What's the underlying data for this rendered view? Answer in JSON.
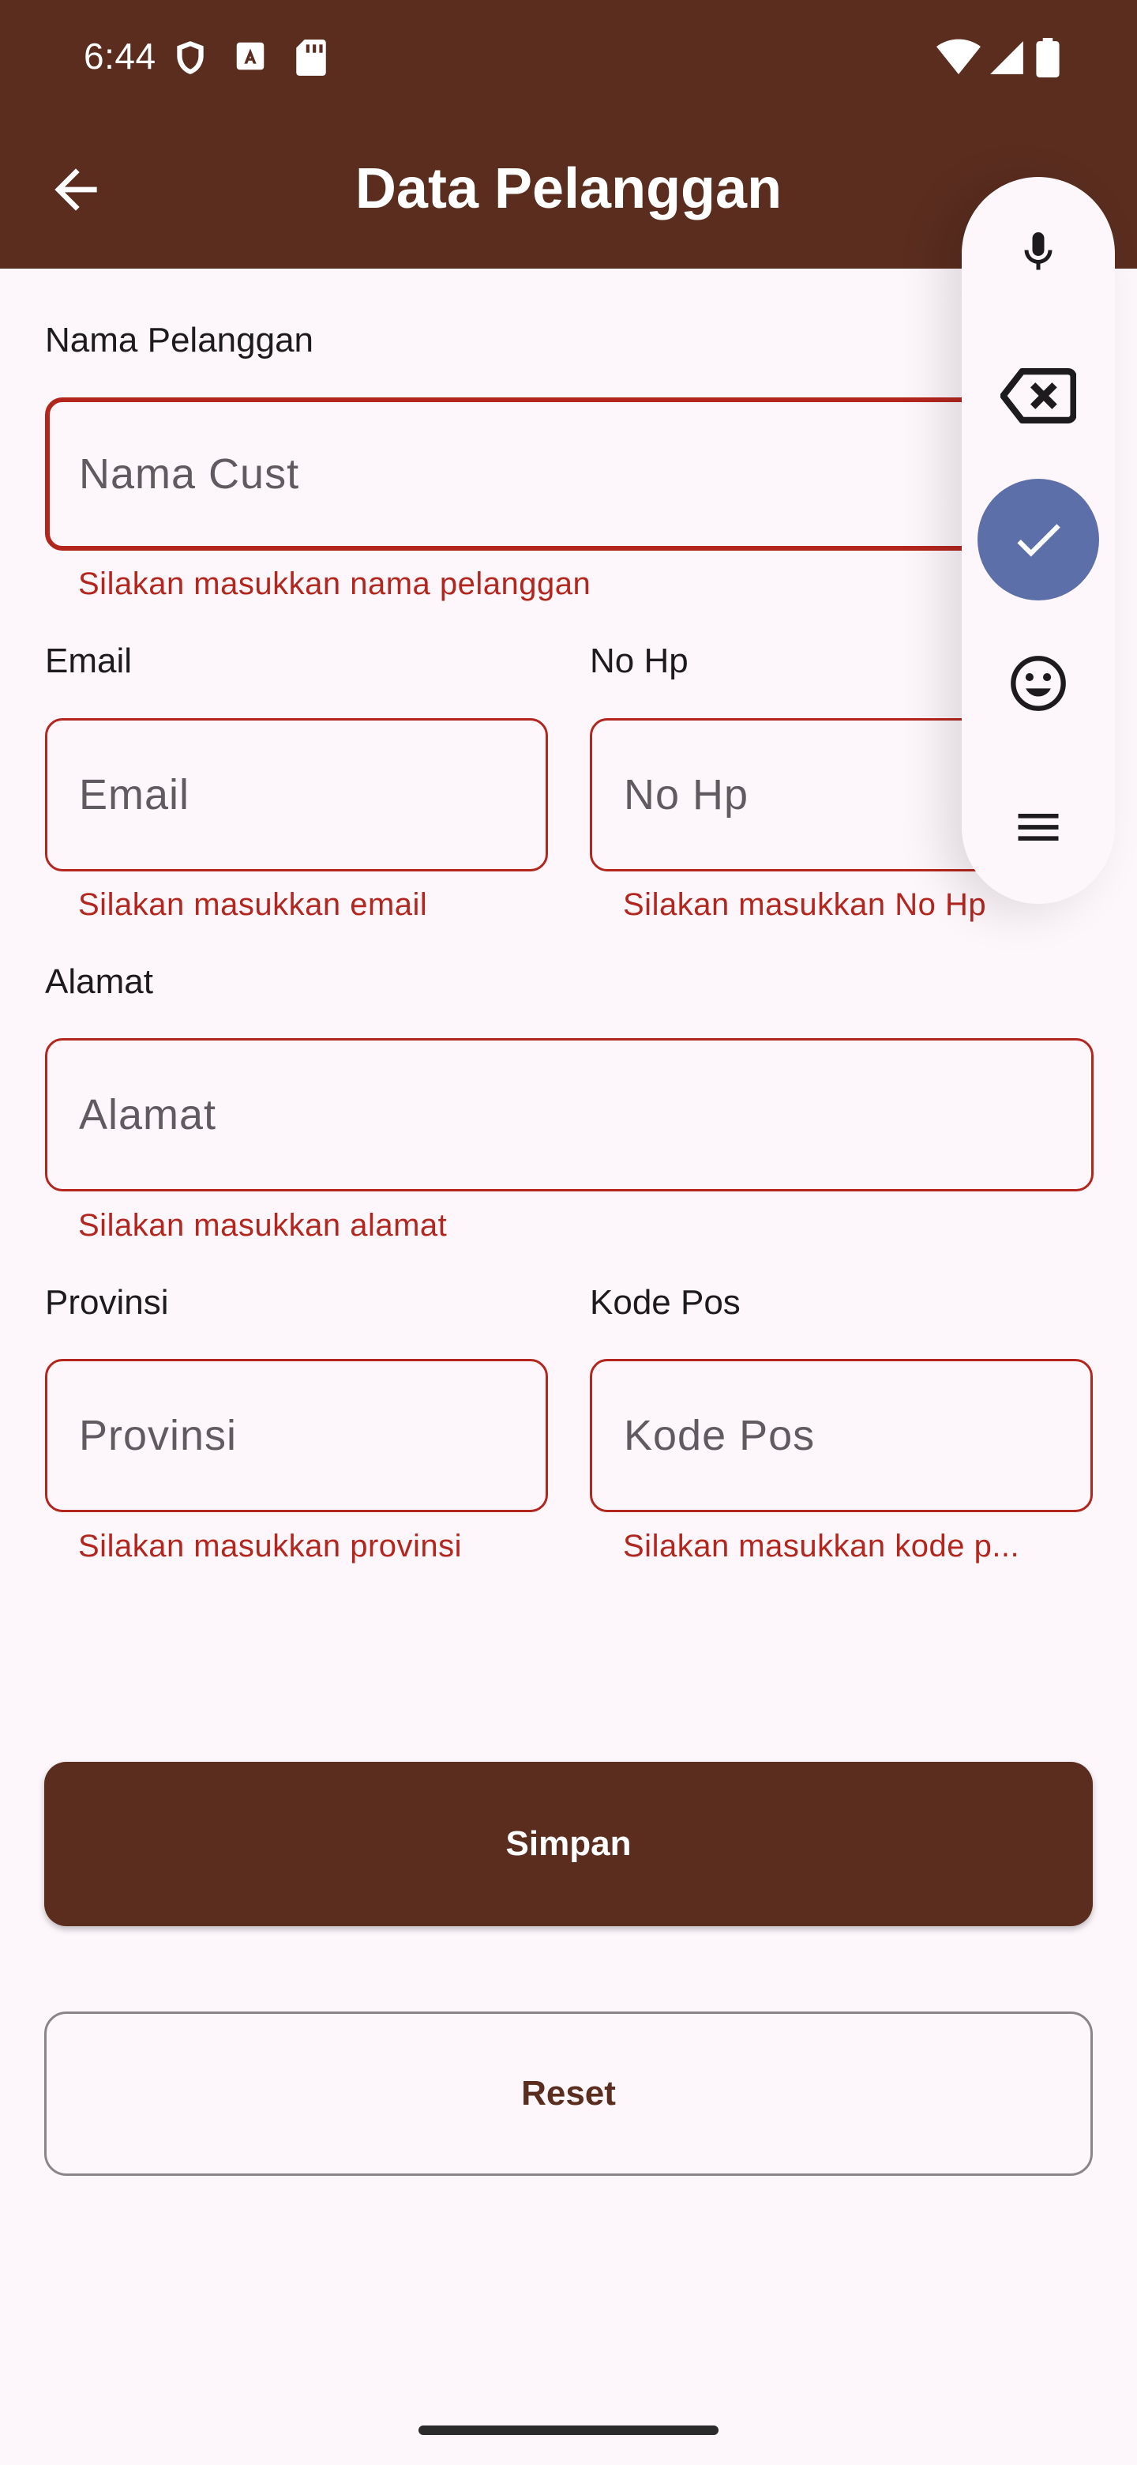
{
  "status_bar": {
    "time": "6:44"
  },
  "app_bar": {
    "title": "Data Pelanggan"
  },
  "form": {
    "nama": {
      "label": "Nama Pelanggan",
      "placeholder": "Nama Cust",
      "error": "Silakan masukkan nama pelanggan"
    },
    "email": {
      "label": "Email",
      "placeholder": "Email",
      "error": "Silakan masukkan email"
    },
    "nohp": {
      "label": "No Hp",
      "placeholder": "No Hp",
      "error": "Silakan masukkan No Hp"
    },
    "alamat": {
      "label": "Alamat",
      "placeholder": "Alamat",
      "error": "Silakan masukkan alamat"
    },
    "provinsi": {
      "label": "Provinsi",
      "placeholder": "Provinsi",
      "error": "Silakan masukkan provinsi"
    },
    "kodepos": {
      "label": "Kode Pos",
      "placeholder": "Kode Pos",
      "error": "Silakan masukkan kode p..."
    }
  },
  "buttons": {
    "save": "Simpan",
    "reset": "Reset"
  },
  "keyboard_toolbar": [
    "mic-icon",
    "backspace-icon",
    "check-icon",
    "emoji-icon",
    "menu-icon"
  ],
  "colors": {
    "primary": "#5a2d1f",
    "error": "#b3261e",
    "background": "#fdf7fc",
    "accent": "#5c6fa8"
  }
}
